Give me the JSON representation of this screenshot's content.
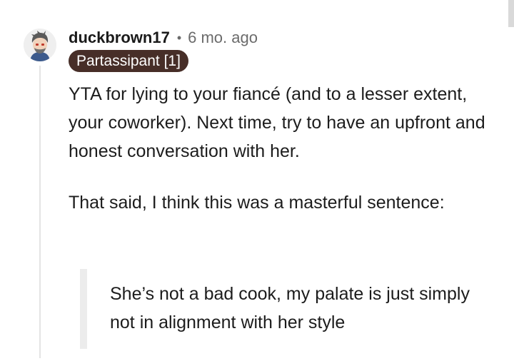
{
  "comment": {
    "author": "duckbrown17",
    "separator": "•",
    "timestamp": "6 mo. ago",
    "flair": "Partassipant [1]",
    "paragraphs": [
      "YTA for lying to your fiancé (and to a lesser extent, your coworker). Next time, try to have an upfront and honest conversation with her.",
      "That said, I think this was a masterful sentence:"
    ],
    "quote": "She’s not a bad cook, my palate is just simply not in alignment with her style"
  },
  "colors": {
    "flair_background": "#472e28",
    "flair_text": "#ffffff",
    "meta_text": "#6b6b6b",
    "body_text": "#1c1c1c",
    "thread_line": "#e4e4e4",
    "quote_bar": "#ececec"
  },
  "icons": {
    "avatar": "user-avatar-icon"
  }
}
